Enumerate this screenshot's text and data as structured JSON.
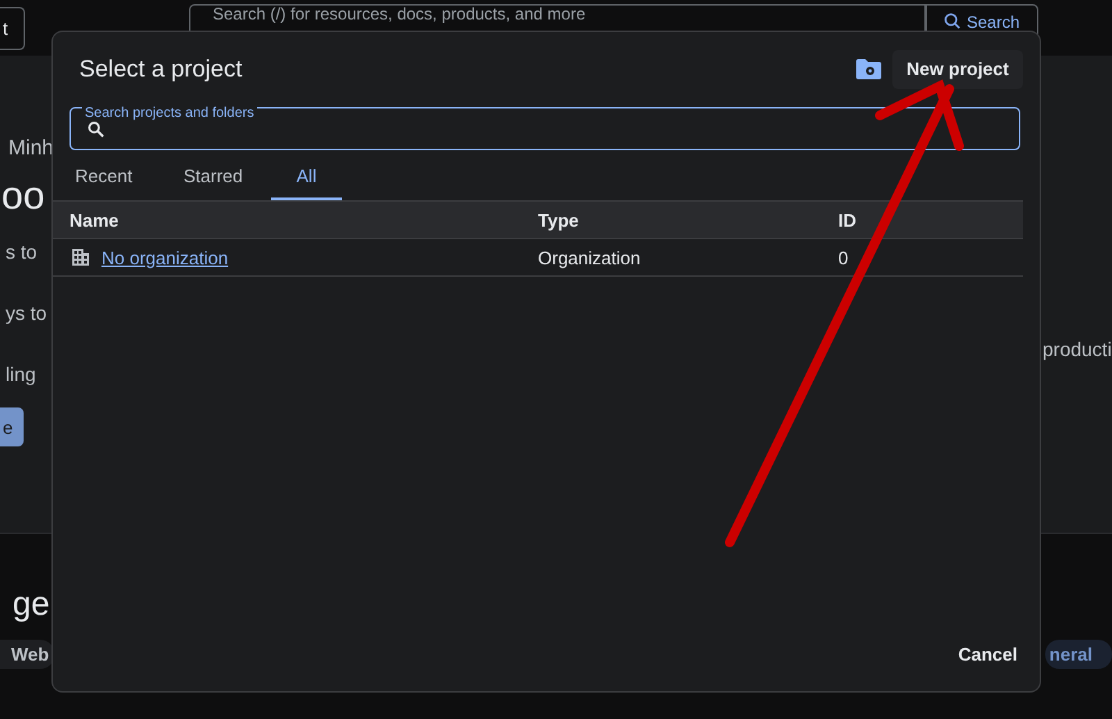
{
  "background_page": {
    "header": {
      "button_label": "t",
      "search": {
        "placeholder": "Search (/) for resources, docs, products, and more"
      },
      "search_button": "Search"
    },
    "left_texts": [
      {
        "kind": "text",
        "text": "Minh"
      },
      {
        "kind": "heading",
        "text": "oo"
      },
      {
        "kind": "text",
        "text": "s to"
      },
      {
        "kind": "text",
        "text": "ys to"
      },
      {
        "kind": "text",
        "text": "ling"
      },
      {
        "kind": "button",
        "text": "e"
      }
    ],
    "right_text": "producti",
    "section_heading": "ge",
    "chips": [
      {
        "label": "Web",
        "selected": false
      },
      {
        "label": "neral",
        "selected": true
      }
    ]
  },
  "dialog": {
    "title": "Select a project",
    "new_project_button": "New project",
    "search": {
      "label": "Search projects and folders"
    },
    "tabs": [
      {
        "label": "Recent",
        "selected": false
      },
      {
        "label": "Starred",
        "selected": false
      },
      {
        "label": "All",
        "selected": true
      }
    ],
    "table": {
      "columns": [
        "Name",
        "Type",
        "ID"
      ],
      "rows": [
        {
          "name": "No organization",
          "type": "Organization",
          "id": "0"
        }
      ]
    },
    "cancel_button": "Cancel"
  }
}
